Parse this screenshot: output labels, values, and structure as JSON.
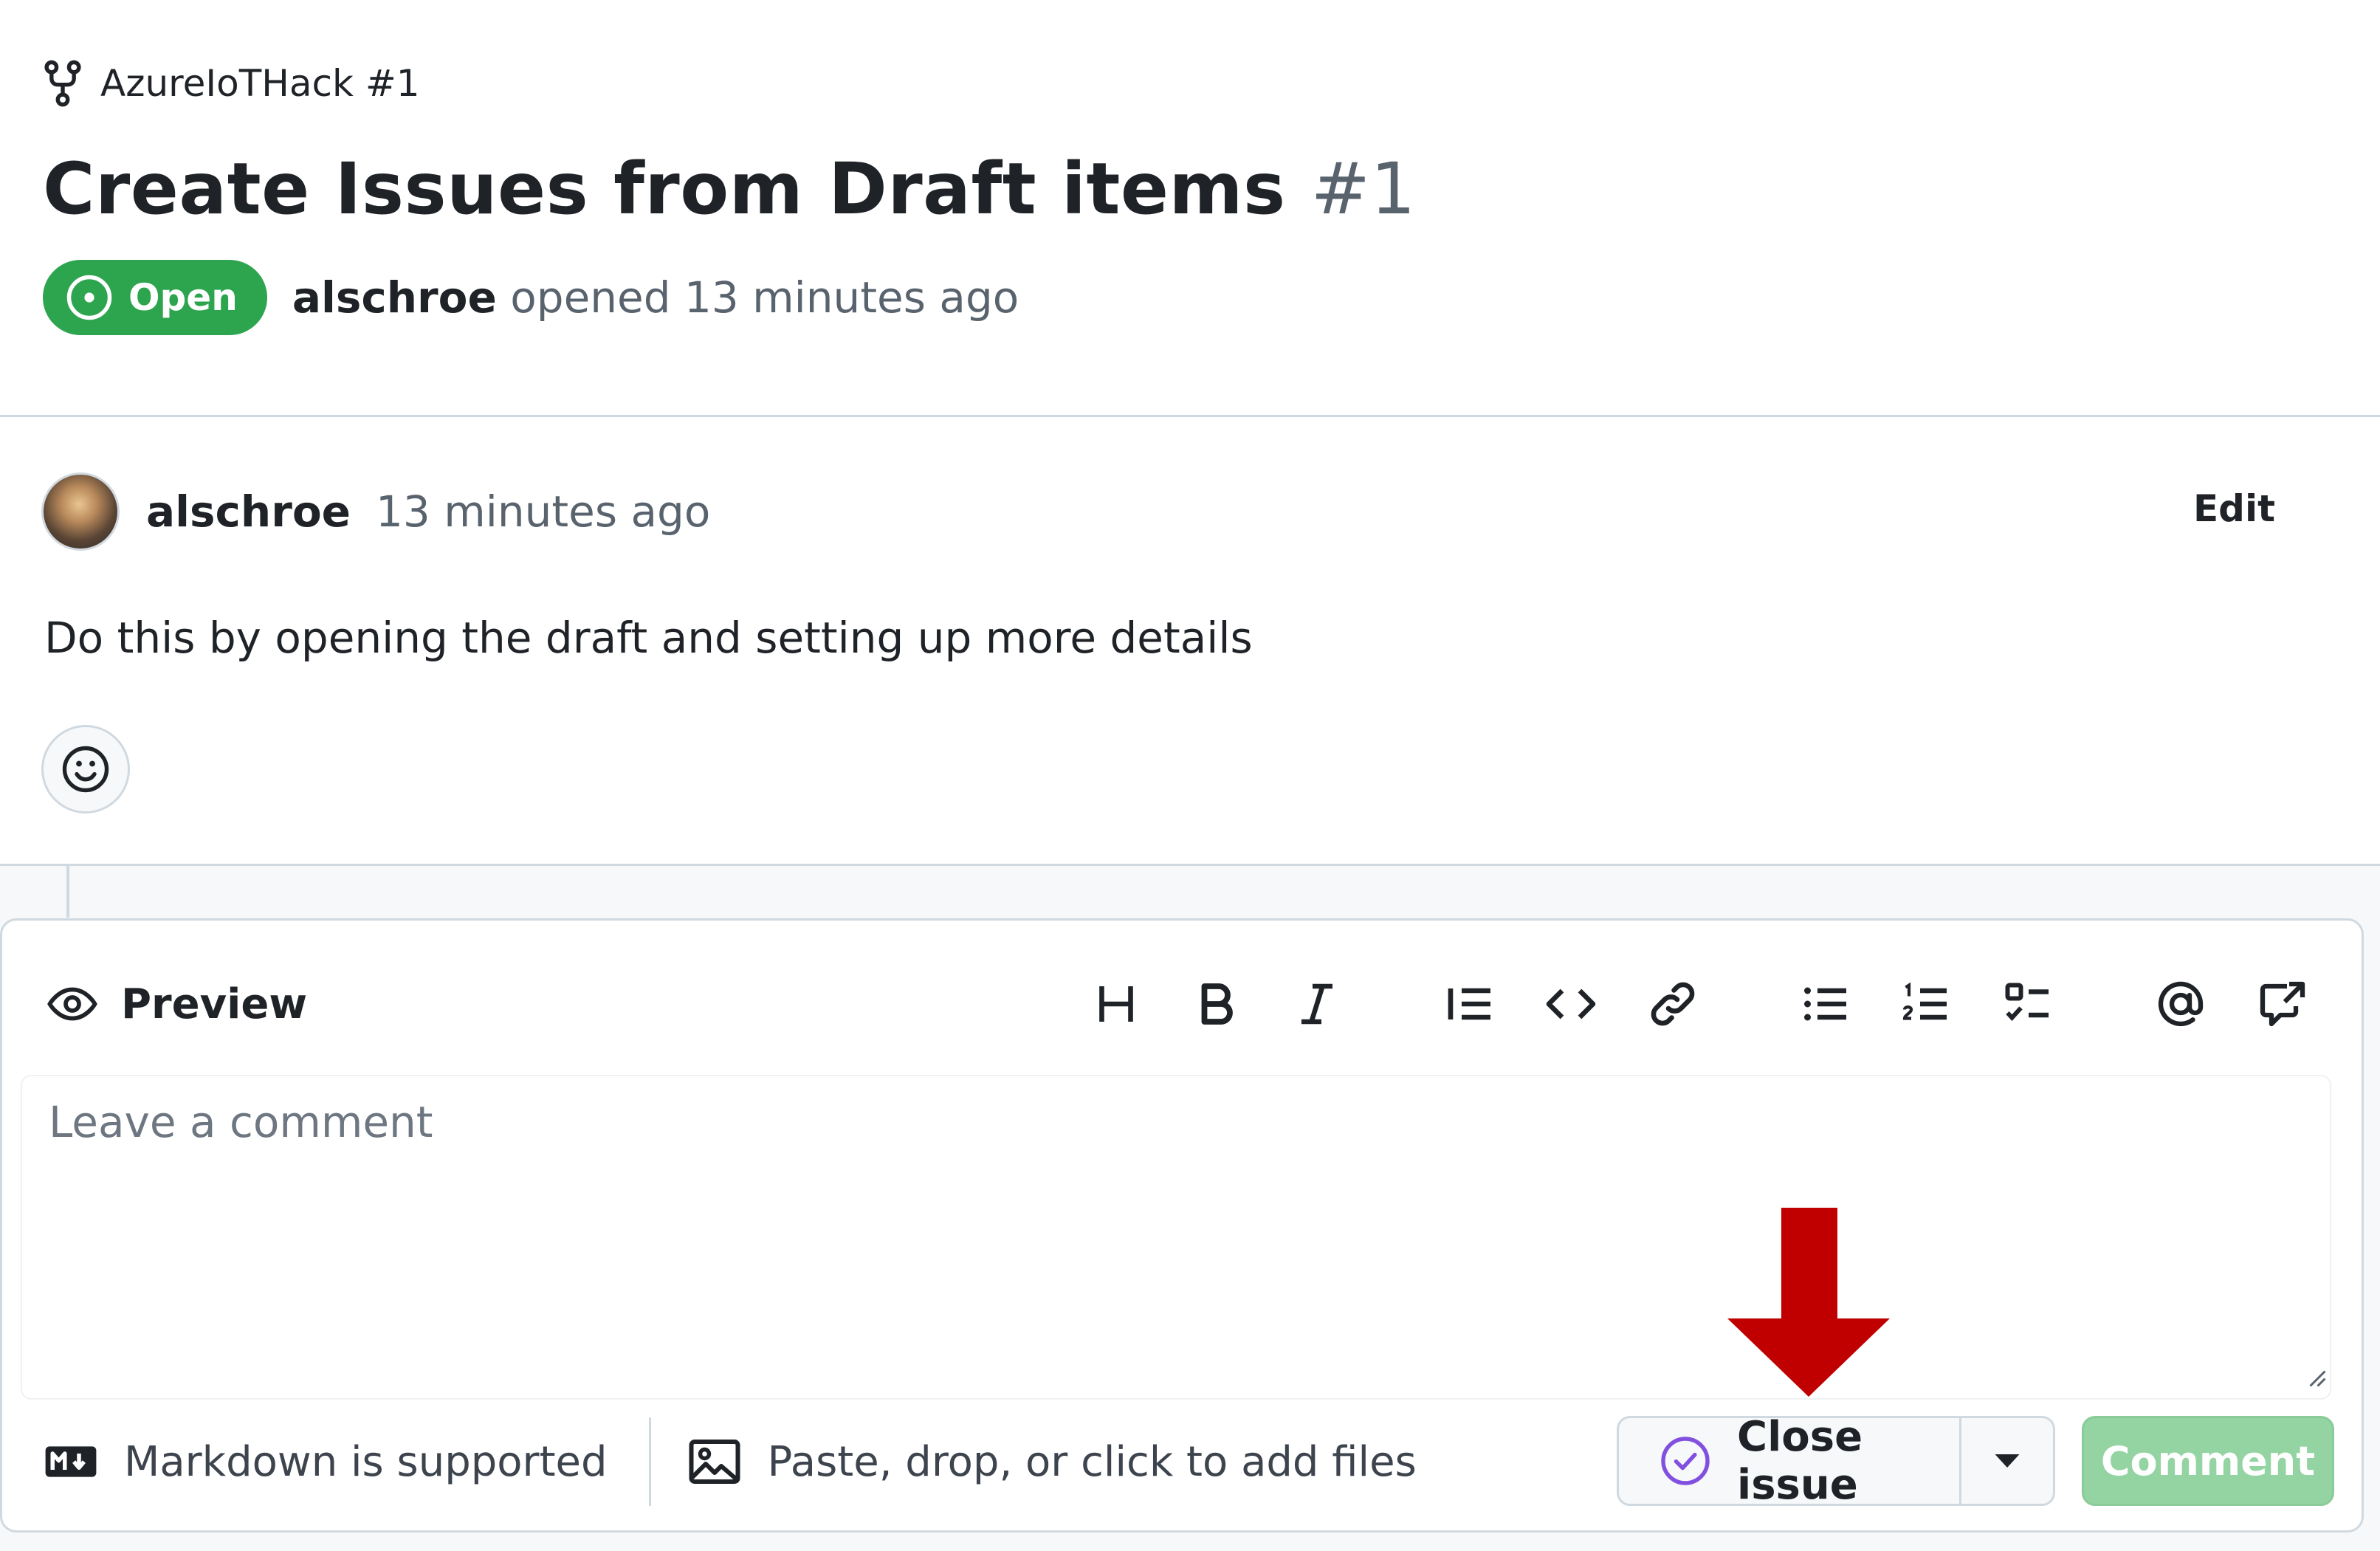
{
  "repo": {
    "name": "AzureIoTHack #1"
  },
  "issue": {
    "title": "Create Issues from Draft items",
    "number": "#1",
    "state": "Open",
    "author": "alschroe",
    "opened_text": "opened 13 minutes ago"
  },
  "comment": {
    "author": "alschroe",
    "time": "13 minutes ago",
    "edit_label": "Edit",
    "body": "Do this by opening the draft and setting up more details"
  },
  "composer": {
    "preview_label": "Preview",
    "placeholder": "Leave a comment",
    "toolbar_icons": [
      "heading-icon",
      "bold-icon",
      "italic-icon",
      "quote-icon",
      "code-icon",
      "link-icon",
      "bulleted-list-icon",
      "numbered-list-icon",
      "task-list-icon",
      "mention-icon",
      "cross-reference-icon"
    ],
    "markdown_note": "Markdown is supported",
    "attach_note": "Paste, drop, or click to add files",
    "close_issue_label": "Close issue",
    "comment_label": "Comment"
  },
  "colors": {
    "open_badge": "#2da44e",
    "close_icon": "#8250df",
    "comment_button_disabled": "#94d3a2",
    "annotation_arrow": "#c00000"
  }
}
